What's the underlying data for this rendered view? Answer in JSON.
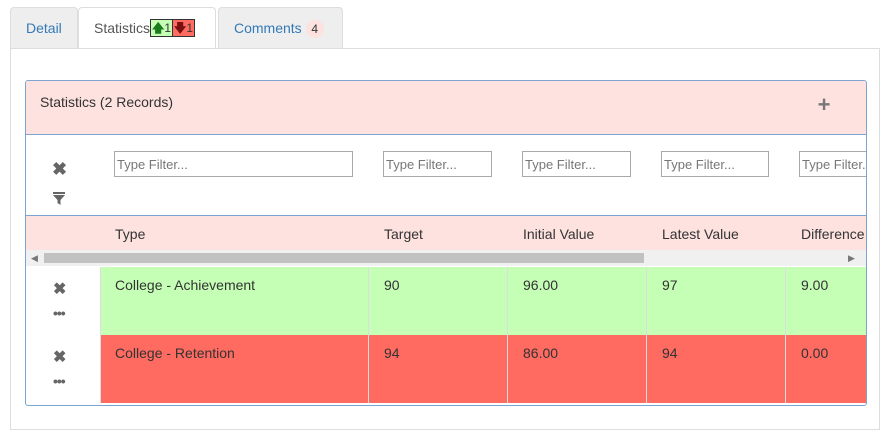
{
  "tabs": {
    "detail": "Detail",
    "statistics": "Statistics",
    "stats_up_count": "1",
    "stats_down_count": "1",
    "comments": "Comments",
    "comments_count": "4"
  },
  "panel": {
    "title": "Statistics (2 Records)",
    "add_icon": "plus-icon"
  },
  "filters": {
    "placeholder": "Type Filter..."
  },
  "columns": [
    "Type",
    "Target",
    "Initial Value",
    "Latest Value",
    "Difference"
  ],
  "rows": [
    {
      "type": "College - Achievement",
      "target": "90",
      "initial": "96.00",
      "latest": "97",
      "difference": "9.00",
      "status": "green"
    },
    {
      "type": "College - Retention",
      "target": "94",
      "initial": "86.00",
      "latest": "94",
      "difference": "0.00",
      "status": "red"
    }
  ],
  "colors": {
    "header_bg": "#fde2df",
    "row_green": "#c4ffb5",
    "row_red": "#ff6a61",
    "border_blue": "#7da4cf",
    "link_blue": "#337ab7"
  }
}
